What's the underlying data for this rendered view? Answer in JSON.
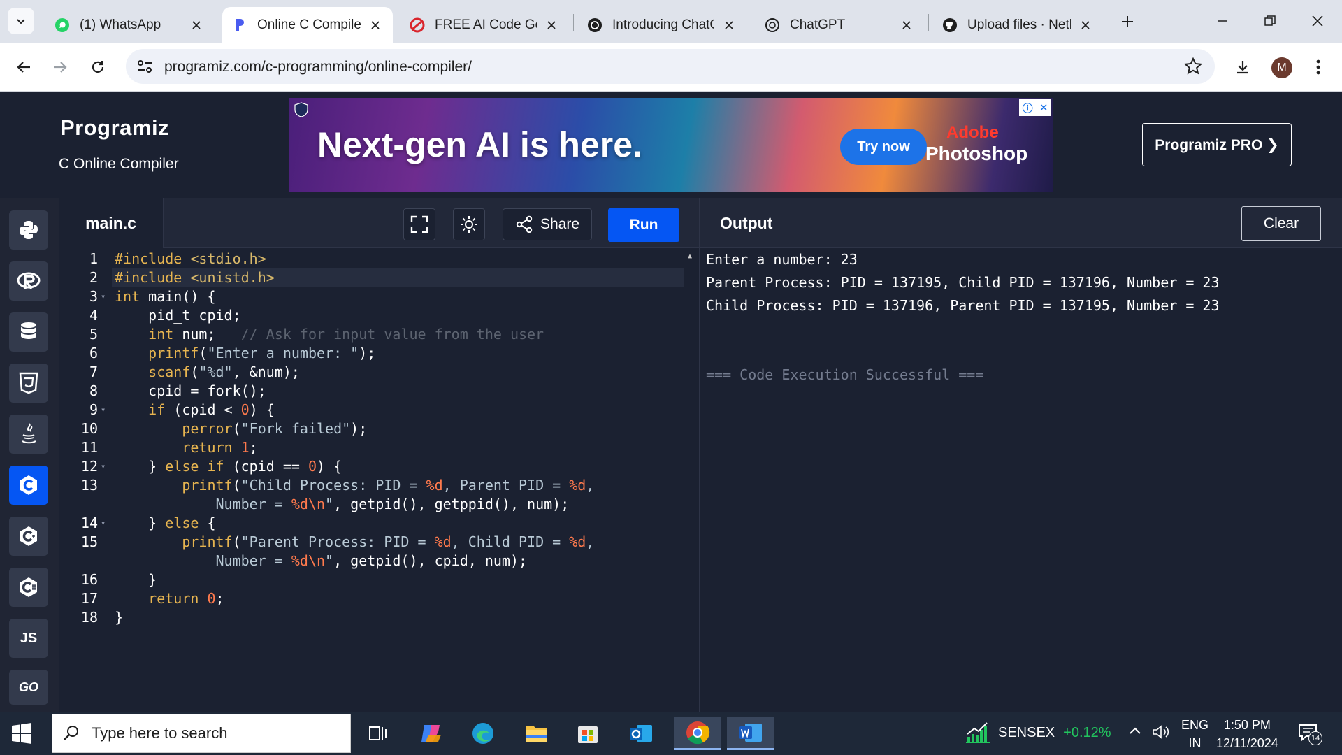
{
  "browser": {
    "tabs": [
      {
        "title": "(1) WhatsApp",
        "icon": "whatsapp-icon",
        "active": false
      },
      {
        "title": "Online C Compiler",
        "icon": "programiz-icon",
        "active": true
      },
      {
        "title": "FREE AI Code Gene",
        "icon": "codeconvert-icon",
        "active": false
      },
      {
        "title": "Introducing ChatG",
        "icon": "openai-icon",
        "active": false
      },
      {
        "title": "ChatGPT",
        "icon": "openai-icon",
        "active": false
      },
      {
        "title": "Upload files · Neth",
        "icon": "github-icon",
        "active": false
      }
    ],
    "url": "programiz.com/c-programming/online-compiler/",
    "avatar_initial": "M"
  },
  "header": {
    "logo": "Programiz",
    "subtitle": "C Online Compiler",
    "ad": {
      "headline": "Next-gen AI is here.",
      "cta": "Try now",
      "brand_top": "Adobe",
      "brand_bottom": "Photoshop"
    },
    "pro_button": "Programiz PRO ❯"
  },
  "sidebar": {
    "languages": [
      {
        "name": "python-icon",
        "glyph": "",
        "active": false
      },
      {
        "name": "r-icon",
        "glyph": "",
        "active": false
      },
      {
        "name": "sql-icon",
        "glyph": "",
        "active": false
      },
      {
        "name": "html-icon",
        "glyph": "",
        "active": false
      },
      {
        "name": "java-icon",
        "glyph": "",
        "active": false
      },
      {
        "name": "c-icon",
        "glyph": "",
        "active": true
      },
      {
        "name": "cpp-icon",
        "glyph": "",
        "active": false
      },
      {
        "name": "csharp-icon",
        "glyph": "",
        "active": false
      },
      {
        "name": "js-icon",
        "glyph": "JS",
        "active": false
      },
      {
        "name": "go-icon",
        "glyph": "GO",
        "active": false
      }
    ]
  },
  "editor": {
    "file_name": "main.c",
    "share_label": "Share",
    "run_label": "Run",
    "lines": [
      {
        "n": "1",
        "fold": false,
        "html": "<span class=\"k\">#include</span> <span class=\"inc\">&lt;stdio.h&gt;</span>"
      },
      {
        "n": "2",
        "fold": false,
        "html": "<span class=\"k\">#include</span> <span class=\"inc\">&lt;unistd.h&gt;</span>"
      },
      {
        "n": "3",
        "fold": true,
        "html": "<span class=\"k\">int</span> main() {"
      },
      {
        "n": "4",
        "fold": false,
        "html": "    pid_t cpid;"
      },
      {
        "n": "5",
        "fold": false,
        "html": "    <span class=\"k\">int</span> num;   <span class=\"cm\">// Ask for input value from the user</span>"
      },
      {
        "n": "6",
        "fold": false,
        "html": "    <span class=\"k\">printf</span>(<span class=\"s\">\"Enter a number: \"</span>);"
      },
      {
        "n": "7",
        "fold": false,
        "html": "    <span class=\"k\">scanf</span>(<span class=\"s\">\"%d\"</span>, &amp;num);"
      },
      {
        "n": "8",
        "fold": false,
        "html": "    cpid = fork();"
      },
      {
        "n": "9",
        "fold": true,
        "html": "    <span class=\"k\">if</span> (cpid &lt; <span class=\"num\">0</span>) {"
      },
      {
        "n": "10",
        "fold": false,
        "html": "        <span class=\"k\">perror</span>(<span class=\"s\">\"Fork failed\"</span>);"
      },
      {
        "n": "11",
        "fold": false,
        "html": "        <span class=\"k\">return</span> <span class=\"num\">1</span>;"
      },
      {
        "n": "12",
        "fold": true,
        "html": "    } <span class=\"k\">else if</span> (cpid == <span class=\"num\">0</span>) {"
      },
      {
        "n": "13",
        "fold": false,
        "html": "        <span class=\"k\">printf</span>(<span class=\"s\">\"Child Process: PID = <span class=\"num\">%d</span>, Parent PID = <span class=\"num\">%d</span>,</span>"
      },
      {
        "n": "",
        "fold": false,
        "html": "            <span class=\"s\">Number = <span class=\"num\">%d\\n</span>\"</span>, getpid(), getppid(), num);"
      },
      {
        "n": "14",
        "fold": true,
        "html": "    } <span class=\"k\">else</span> {"
      },
      {
        "n": "15",
        "fold": false,
        "html": "        <span class=\"k\">printf</span>(<span class=\"s\">\"Parent Process: PID = <span class=\"num\">%d</span>, Child PID = <span class=\"num\">%d</span>,</span>"
      },
      {
        "n": "",
        "fold": false,
        "html": "            <span class=\"s\">Number = <span class=\"num\">%d\\n</span>\"</span>, getpid(), cpid, num);"
      },
      {
        "n": "16",
        "fold": false,
        "html": "    }"
      },
      {
        "n": "17",
        "fold": false,
        "html": "    <span class=\"k\">return</span> <span class=\"num\">0</span>;"
      },
      {
        "n": "18",
        "fold": false,
        "html": "}"
      }
    ]
  },
  "output": {
    "title": "Output",
    "clear_label": "Clear",
    "lines": [
      "Enter a number: 23",
      "Parent Process: PID = 137195, Child PID = 137196, Number = 23",
      "Child Process: PID = 137196, Parent PID = 137195, Number = 23"
    ],
    "status": "=== Code Execution Successful ==="
  },
  "taskbar": {
    "search_placeholder": "Type here to search",
    "ticker_name": "SENSEX",
    "ticker_change": "+0.12%",
    "lang_top": "ENG",
    "lang_bottom": "IN",
    "time": "1:50 PM",
    "date": "12/11/2024",
    "notification_count": "14"
  },
  "colors": {
    "accent": "#0556f3",
    "panel_bg": "#1b2131",
    "success_green": "#22c55e"
  }
}
